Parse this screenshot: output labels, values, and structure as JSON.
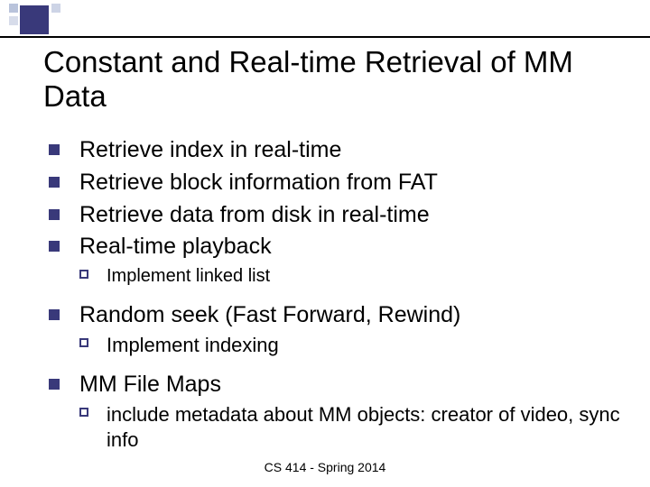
{
  "title": "Constant and Real-time Retrieval of MM Data",
  "bullets": {
    "b1": "Retrieve index in real-time",
    "b2": "Retrieve block information from FAT",
    "b3": "Retrieve data from disk in real-time",
    "b4": "Real-time playback",
    "b4_sub1": "Implement linked list",
    "b5": "Random seek (Fast Forward, Rewind)",
    "b5_sub1": "Implement indexing",
    "b6": "MM File Maps",
    "b6_sub1": "include metadata about MM objects: creator of video, sync info"
  },
  "footer": "CS 414 - Spring 2014"
}
